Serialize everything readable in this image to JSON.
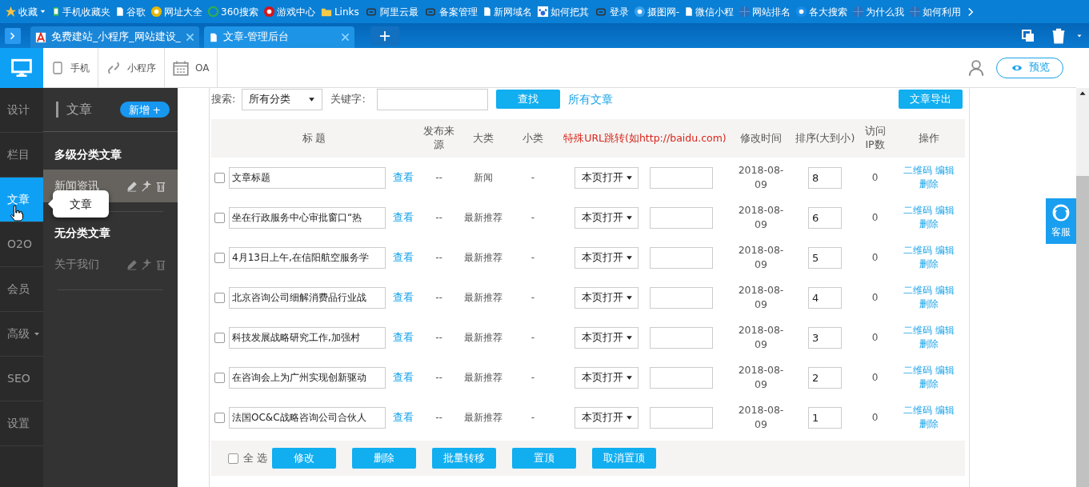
{
  "bookmarks": [
    {
      "label": "收藏",
      "kind": "star",
      "dropdown": true
    },
    {
      "label": "手机收藏夹",
      "kind": "phone",
      "dropdown": false
    },
    {
      "label": "谷歌",
      "kind": "page",
      "dropdown": false
    },
    {
      "label": "网址大全",
      "kind": "badge",
      "color": "#e6b800",
      "dropdown": false
    },
    {
      "label": "360搜索",
      "kind": "ring",
      "color": "#2eae4f",
      "dropdown": false
    },
    {
      "label": "游戏中心",
      "kind": "badge",
      "color": "#d7141a",
      "dropdown": false
    },
    {
      "label": "Links",
      "kind": "folder",
      "dropdown": false
    },
    {
      "label": "阿里云最",
      "kind": "cloud",
      "dropdown": false
    },
    {
      "label": "备案管理",
      "kind": "cloud",
      "dropdown": false
    },
    {
      "label": "新网域名",
      "kind": "page",
      "dropdown": false
    },
    {
      "label": "如何把其",
      "kind": "paw",
      "dropdown": false
    },
    {
      "label": "登录",
      "kind": "cloud",
      "dropdown": false
    },
    {
      "label": "摄图网-",
      "kind": "badge",
      "color": "#39a0e8",
      "dropdown": false
    },
    {
      "label": "微信小程",
      "kind": "page",
      "dropdown": false
    },
    {
      "label": "网站排名",
      "kind": "globe",
      "dropdown": false
    },
    {
      "label": "各大搜索",
      "kind": "badge",
      "color": "#1a8ce8",
      "dropdown": false
    },
    {
      "label": "为什么我",
      "kind": "globe",
      "dropdown": false
    },
    {
      "label": "如何利用",
      "kind": "globe",
      "dropdown": false
    }
  ],
  "browser_tabs": [
    {
      "title": "免费建站_小程序_网站建设_",
      "selected": false
    },
    {
      "title": "文章-管理后台",
      "selected": true
    }
  ],
  "top_bar": {
    "modes": [
      {
        "label": "手机",
        "kind": "phone"
      },
      {
        "label": "小程序",
        "kind": "link"
      },
      {
        "label": "OA",
        "kind": "calendar"
      }
    ],
    "preview_button": "预览"
  },
  "nav": [
    {
      "label": "设计",
      "selected": false,
      "dropdown": false
    },
    {
      "label": "栏目",
      "selected": false,
      "dropdown": false
    },
    {
      "label": "文章",
      "selected": true,
      "dropdown": false
    },
    {
      "label": "O2O",
      "selected": false,
      "dropdown": false
    },
    {
      "label": "会员",
      "selected": false,
      "dropdown": false
    },
    {
      "label": "高级",
      "selected": false,
      "dropdown": true
    },
    {
      "label": "SEO",
      "selected": false,
      "dropdown": false
    },
    {
      "label": "设置",
      "selected": false,
      "dropdown": false
    }
  ],
  "tooltip": "文章",
  "category_panel": {
    "title": "文章",
    "add_button": "新增 +",
    "groups": [
      {
        "title": "多级分类文章",
        "items": [
          {
            "label": "新闻资讯",
            "selected": true
          }
        ]
      },
      {
        "title": "无分类文章",
        "items": [
          {
            "label": "关于我们",
            "selected": false
          }
        ]
      }
    ]
  },
  "search": {
    "label": "搜索:",
    "category": "所有分类",
    "keyword_label": "关键字:",
    "find_button": "查找",
    "all_link": "所有文章",
    "export_button": "文章导出"
  },
  "table": {
    "columns": [
      {
        "label": "标 题",
        "warning": false
      },
      {
        "label": "发布来源",
        "warning": false
      },
      {
        "label": "大类",
        "warning": false
      },
      {
        "label": "小类",
        "warning": false
      },
      {
        "label": "特殊URL跳转(如http://baidu.com)",
        "warning": true
      },
      {
        "label": "修改时间",
        "warning": false
      },
      {
        "label": "排序(大到小)",
        "warning": false
      },
      {
        "label": "访问IP数",
        "warning": false
      },
      {
        "label": "操作",
        "warning": false
      }
    ],
    "rows": [
      {
        "checked": false,
        "title": "文章标题",
        "view": "查看",
        "source": "--",
        "category": "新闻",
        "subcategory": "-",
        "target": "本页打开",
        "date": "2018-08-09",
        "sort": "8",
        "ip": "0",
        "actions": [
          "二维码",
          "编辑",
          "删除"
        ]
      },
      {
        "checked": false,
        "title": "坐在行政服务中心审批窗口“热",
        "view": "查看",
        "source": "--",
        "category": "最新推荐",
        "subcategory": "-",
        "target": "本页打开",
        "date": "2018-08-09",
        "sort": "6",
        "ip": "0",
        "actions": [
          "二维码",
          "编辑",
          "删除"
        ]
      },
      {
        "checked": false,
        "title": "4月13日上午,在信阳航空服务学",
        "view": "查看",
        "source": "--",
        "category": "最新推荐",
        "subcategory": "-",
        "target": "本页打开",
        "date": "2018-08-09",
        "sort": "5",
        "ip": "0",
        "actions": [
          "二维码",
          "编辑",
          "删除"
        ]
      },
      {
        "checked": false,
        "title": "北京咨询公司细解消费品行业战",
        "view": "查看",
        "source": "--",
        "category": "最新推荐",
        "subcategory": "-",
        "target": "本页打开",
        "date": "2018-08-09",
        "sort": "4",
        "ip": "0",
        "actions": [
          "二维码",
          "编辑",
          "删除"
        ]
      },
      {
        "checked": false,
        "title": "科技发展战略研究工作,加强村",
        "view": "查看",
        "source": "--",
        "category": "最新推荐",
        "subcategory": "-",
        "target": "本页打开",
        "date": "2018-08-09",
        "sort": "3",
        "ip": "0",
        "actions": [
          "二维码",
          "编辑",
          "删除"
        ]
      },
      {
        "checked": false,
        "title": "在咨询会上为广州实现创新驱动",
        "view": "查看",
        "source": "--",
        "category": "最新推荐",
        "subcategory": "-",
        "target": "本页打开",
        "date": "2018-08-09",
        "sort": "2",
        "ip": "0",
        "actions": [
          "二维码",
          "编辑",
          "删除"
        ]
      },
      {
        "checked": false,
        "title": "法国OC&C战略咨询公司合伙人",
        "view": "查看",
        "source": "--",
        "category": "最新推荐",
        "subcategory": "-",
        "target": "本页打开",
        "date": "2018-08-09",
        "sort": "1",
        "ip": "0",
        "actions": [
          "二维码",
          "编辑",
          "删除"
        ]
      }
    ]
  },
  "footer": {
    "select_all": {
      "label": "全 选",
      "checked": false
    },
    "buttons": [
      "修改",
      "删除",
      "批量转移",
      "置顶",
      "取消置顶"
    ]
  },
  "service_button": "客服"
}
